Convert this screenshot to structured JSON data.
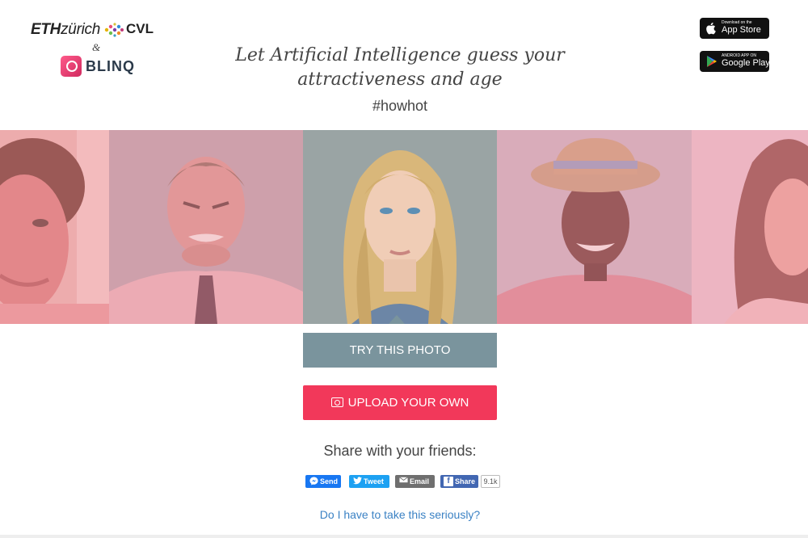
{
  "logos": {
    "eth_bold": "ETH",
    "eth_light": "zürich",
    "cvl": "CVL",
    "ampersand": "&",
    "blinq": "BLINQ"
  },
  "header": {
    "headline_line1": "Let Artificial Intelligence guess your",
    "headline_line2": "attractiveness and age",
    "hashtag": "#howhot"
  },
  "stores": {
    "appstore_small": "Download on the",
    "appstore_big": "App Store",
    "googleplay_small": "ANDROID APP ON",
    "googleplay_big": "Google Play"
  },
  "actions": {
    "try_label": "TRY THIS PHOTO",
    "upload_label": "UPLOAD YOUR OWN"
  },
  "share": {
    "title": "Share with your friends:",
    "send": "Send",
    "tweet": "Tweet",
    "email": "Email",
    "share": "Share",
    "count": "9.1k"
  },
  "footer_link": "Do I have to take this seriously?",
  "colors": {
    "try_button": "#7a949d",
    "upload_button": "#f2385a",
    "link": "#3b82c4",
    "photo_tint": "#f596aa"
  },
  "icons": [
    "apple-icon",
    "google-play-icon",
    "camera-icon",
    "messenger-icon",
    "twitter-icon",
    "email-icon",
    "facebook-icon"
  ]
}
